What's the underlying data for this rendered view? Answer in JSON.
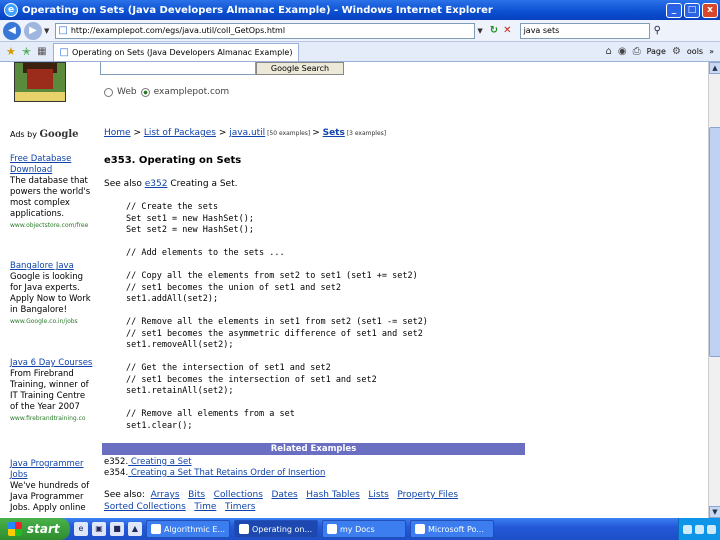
{
  "window": {
    "title": "Operating on Sets (Java Developers Almanac Example) - Windows Internet Explorer",
    "controls": {
      "minimize": "_",
      "maximize": "□",
      "close": "x"
    }
  },
  "address_bar": {
    "url": "http://examplepot.com/egs/java.util/coll_GetOps.html",
    "search_value": "java sets"
  },
  "tab_bar": {
    "tab_title": "Operating on Sets (Java Developers Almanac Example)",
    "page_menu": "Page",
    "tools_menu": "ools",
    "chevron": "»"
  },
  "page": {
    "google_search_button": "Google Search",
    "radio_web": "Web",
    "radio_site": "examplepot.com",
    "ads_by": "Ads by",
    "ads_by_brand": "Google",
    "breadcrumb": {
      "home": "Home",
      "sep1": " > ",
      "list": "List of Packages",
      "sep2": " > ",
      "pkg": "java.util",
      "pkg_count": " [50 examples] ",
      "sep3": "> ",
      "sets": "Sets",
      "sets_count": " [3 examples]"
    },
    "heading": "e353. Operating on Sets",
    "see_also_prefix": "See also ",
    "see_also_link": "e352",
    "see_also_text": " Creating a Set.",
    "code": "// Create the sets\nSet set1 = new HashSet();\nSet set2 = new HashSet();\n\n// Add elements to the sets ...\n\n// Copy all the elements from set2 to set1 (set1 += set2)\n// set1 becomes the union of set1 and set2\nset1.addAll(set2);\n\n// Remove all the elements in set1 from set2 (set1 -= set2)\n// set1 becomes the asymmetric difference of set1 and set2\nset1.removeAll(set2);\n\n// Get the intersection of set1 and set2\n// set1 becomes the intersection of set1 and set2\nset1.retainAll(set2);\n\n// Remove all elements from a set\nset1.clear();",
    "related_title": "Related Examples",
    "related": [
      {
        "id": "e352.",
        "text": " Creating a Set"
      },
      {
        "id": "e354.",
        "text": " Creating a Set That Retains Order of Insertion"
      }
    ],
    "bottom_see_also": "See also:",
    "bottom_links": [
      "Arrays",
      "Bits",
      "Collections",
      "Dates",
      "Hash Tables",
      "Lists",
      "Property Files"
    ],
    "bottom_links2": [
      "Sorted Collections",
      "Time",
      "Timers"
    ]
  },
  "ads": [
    {
      "title": "Free Database Download",
      "body": "The database that powers the world's most complex applications.",
      "url": "www.objectstore.com/free"
    },
    {
      "title": "Bangalore Java",
      "body": "Google is looking for Java experts. Apply Now to Work in Bangalore!",
      "url": "www.Google.co.in/jobs"
    },
    {
      "title": "Java 6 Day Courses",
      "body": "From Firebrand Training, winner of IT Training Centre of the Year 2007",
      "url": "www.firebrandtraining.co"
    },
    {
      "title": "Java Programmer Jobs",
      "body": "We've hundreds of Java Programmer Jobs. Apply online",
      "url": ""
    }
  ],
  "taskbar": {
    "start": "start",
    "tasks": [
      "Algorithmic E...",
      "Operating on...",
      "my Docs",
      "Microsoft Po..."
    ]
  }
}
